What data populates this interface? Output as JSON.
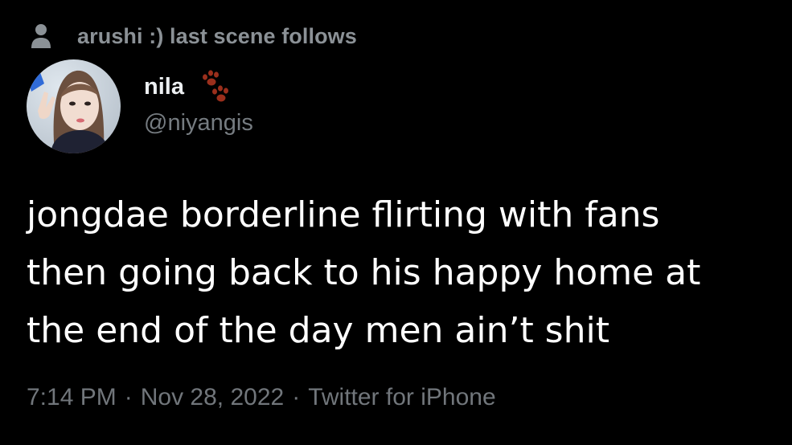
{
  "social_context": {
    "icon": "person-icon",
    "text": "arushi :) last scene follows"
  },
  "author": {
    "avatar": "avatar",
    "display_name": "nila",
    "name_emoji": "paw-prints-icon",
    "handle": "@niyangis"
  },
  "tweet": {
    "lines": [
      "jongdae borderline flirting with fans",
      "then going back to his happy home at",
      "the end of the day men ain’t shit"
    ]
  },
  "meta": {
    "time": "7:14 PM",
    "separator": "·",
    "date": "Nov 28, 2022",
    "source": "Twitter for iPhone"
  },
  "colors": {
    "background": "#000000",
    "primary_text": "#ffffff",
    "secondary_text": "#71767b",
    "paw_color": "#9b2f1c"
  }
}
